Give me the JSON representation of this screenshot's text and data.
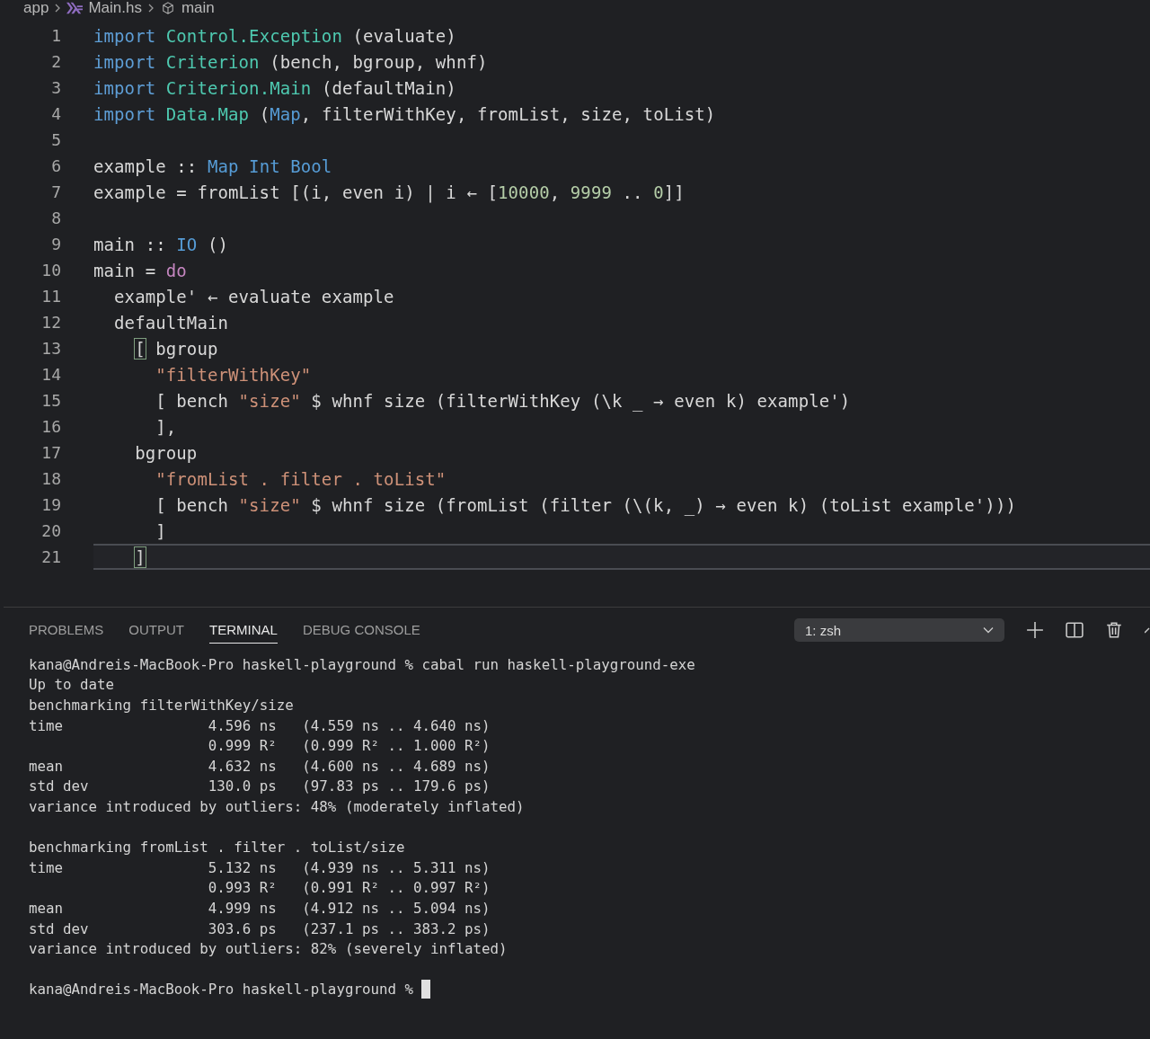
{
  "breadcrumb": [
    {
      "label": "app",
      "kind": "folder"
    },
    {
      "label": "Main.hs",
      "kind": "file"
    },
    {
      "label": "main",
      "kind": "symbol"
    }
  ],
  "editor": {
    "lines": [
      {
        "number": "1",
        "current": false,
        "tokens": [
          {
            "kind": "keyword",
            "text": "import"
          },
          {
            "kind": "module",
            "text": " Control.Exception"
          },
          {
            "kind": "plain",
            "text": " (evaluate)"
          }
        ]
      },
      {
        "number": "2",
        "current": false,
        "tokens": [
          {
            "kind": "keyword",
            "text": "import"
          },
          {
            "kind": "module",
            "text": " Criterion"
          },
          {
            "kind": "plain",
            "text": " (bench, bgroup, whnf)"
          }
        ]
      },
      {
        "number": "3",
        "current": false,
        "tokens": [
          {
            "kind": "keyword",
            "text": "import"
          },
          {
            "kind": "module",
            "text": " Criterion.Main"
          },
          {
            "kind": "plain",
            "text": " (defaultMain)"
          }
        ]
      },
      {
        "number": "4",
        "current": false,
        "tokens": [
          {
            "kind": "keyword",
            "text": "import"
          },
          {
            "kind": "module",
            "text": " Data.Map"
          },
          {
            "kind": "plain",
            "text": " ("
          },
          {
            "kind": "type",
            "text": "Map"
          },
          {
            "kind": "plain",
            "text": ", filterWithKey, fromList, size, toList)"
          }
        ]
      },
      {
        "number": "5",
        "current": false
      },
      {
        "number": "6",
        "current": false,
        "tokens": [
          {
            "kind": "plain",
            "text": "example :: "
          },
          {
            "kind": "type",
            "text": "Map Int Bool"
          }
        ]
      },
      {
        "number": "7",
        "current": false,
        "tokens": [
          {
            "kind": "plain",
            "text": "example = fromList [(i, even i) | i ← ["
          },
          {
            "kind": "number",
            "text": "10000"
          },
          {
            "kind": "plain",
            "text": ", "
          },
          {
            "kind": "number",
            "text": "9999"
          },
          {
            "kind": "plain",
            "text": " .. "
          },
          {
            "kind": "number",
            "text": "0"
          },
          {
            "kind": "plain",
            "text": "]]"
          }
        ]
      },
      {
        "number": "8",
        "current": false
      },
      {
        "number": "9",
        "current": false,
        "tokens": [
          {
            "kind": "plain",
            "text": "main :: "
          },
          {
            "kind": "type",
            "text": "IO"
          },
          {
            "kind": "plain",
            "text": " ()"
          }
        ]
      },
      {
        "number": "10",
        "current": false,
        "tokens": [
          {
            "kind": "plain",
            "text": "main = "
          },
          {
            "kind": "control",
            "text": "do"
          }
        ]
      },
      {
        "number": "11",
        "current": false,
        "tokens": [
          {
            "kind": "plain",
            "text": "  example' ← evaluate example"
          }
        ]
      },
      {
        "number": "12",
        "current": false,
        "tokens": [
          {
            "kind": "plain",
            "text": "  defaultMain"
          }
        ]
      },
      {
        "number": "13",
        "current": false,
        "tokens": [
          {
            "kind": "bracket_match",
            "text": "    ["
          },
          {
            "kind": "plain",
            "text": " bgroup"
          }
        ]
      },
      {
        "number": "14",
        "current": false,
        "tokens": [
          {
            "kind": "string",
            "text": "      \"filterWithKey\""
          }
        ]
      },
      {
        "number": "15",
        "current": false,
        "tokens": [
          {
            "kind": "plain",
            "text": "      [ bench "
          },
          {
            "kind": "string",
            "text": "\"size\""
          },
          {
            "kind": "plain",
            "text": " $ whnf size (filterWithKey (\\k _ → even k) example')"
          }
        ]
      },
      {
        "number": "16",
        "current": false,
        "tokens": [
          {
            "kind": "plain",
            "text": "      ],"
          }
        ]
      },
      {
        "number": "17",
        "current": false,
        "tokens": [
          {
            "kind": "plain",
            "text": "    bgroup"
          }
        ]
      },
      {
        "number": "18",
        "current": false,
        "tokens": [
          {
            "kind": "string",
            "text": "      \"fromList . filter . toList\""
          }
        ]
      },
      {
        "number": "19",
        "current": false,
        "tokens": [
          {
            "kind": "plain",
            "text": "      [ bench "
          },
          {
            "kind": "string",
            "text": "\"size\""
          },
          {
            "kind": "plain",
            "text": " $ whnf size (fromList (filter (\\(k, _) → even k) (toList example')))"
          }
        ]
      },
      {
        "number": "20",
        "current": false,
        "tokens": [
          {
            "kind": "plain",
            "text": "      ]"
          }
        ]
      },
      {
        "number": "21",
        "current": true,
        "tokens": [
          {
            "kind": "bracket_match",
            "text": "    ]"
          }
        ]
      }
    ]
  },
  "panel": {
    "tabs": [
      {
        "label": "PROBLEMS",
        "selected": false
      },
      {
        "label": "OUTPUT",
        "selected": false
      },
      {
        "label": "TERMINAL",
        "selected": true
      },
      {
        "label": "DEBUG CONSOLE",
        "selected": false
      }
    ],
    "terminal_select": {
      "value": "1: zsh"
    },
    "terminal": {
      "cursor": true,
      "blocks": [
        [
          "kana@Andreis-MacBook-Pro haskell-playground % cabal run haskell-playground-exe",
          "Up to date",
          "benchmarking filterWithKey/size",
          "time                 4.596 ns   (4.559 ns .. 4.640 ns)",
          "                     0.999 R²   (0.999 R² .. 1.000 R²)",
          "mean                 4.632 ns   (4.600 ns .. 4.689 ns)",
          "std dev              130.0 ps   (97.83 ps .. 179.6 ps)",
          "variance introduced by outliers: 48% (moderately inflated)"
        ],
        [
          "benchmarking fromList . filter . toList/size",
          "time                 5.132 ns   (4.939 ns .. 5.311 ns)",
          "                     0.993 R²   (0.991 R² .. 0.997 R²)",
          "mean                 4.999 ns   (4.912 ns .. 5.094 ns)",
          "std dev              303.6 ps   (237.1 ps .. 383.2 ps)",
          "variance introduced by outliers: 82% (severely inflated)"
        ],
        [
          "kana@Andreis-MacBook-Pro haskell-playground %"
        ]
      ]
    }
  }
}
